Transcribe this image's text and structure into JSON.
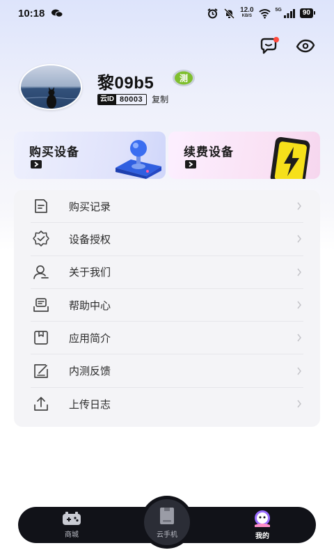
{
  "status_bar": {
    "time": "10:18",
    "net_speed_value": "12.0",
    "net_speed_unit": "KB/S",
    "network_type": "5G",
    "battery": "90"
  },
  "header": {
    "message_icon": "message-bubble-icon",
    "eye_icon": "eye-icon",
    "has_unread_dot": true
  },
  "profile": {
    "username": "黎09b5",
    "badge": "测",
    "cloud_id_label": "云ID",
    "cloud_id_value": "80003",
    "copy_label": "复制"
  },
  "cards": [
    {
      "title": "购买设备",
      "icon": "joystick-icon"
    },
    {
      "title": "续费设备",
      "icon": "lightning-phone-icon"
    }
  ],
  "menu": [
    {
      "label": "购买记录",
      "icon": "purchase-record-icon"
    },
    {
      "label": "设备授权",
      "icon": "device-auth-icon"
    },
    {
      "label": "关于我们",
      "icon": "about-us-icon"
    },
    {
      "label": "帮助中心",
      "icon": "help-center-icon"
    },
    {
      "label": "应用简介",
      "icon": "app-intro-icon"
    },
    {
      "label": "内测反馈",
      "icon": "feedback-icon"
    },
    {
      "label": "上传日志",
      "icon": "upload-log-icon"
    }
  ],
  "bottom_nav": [
    {
      "label": "商城",
      "icon": "gamepad-icon",
      "active": false
    },
    {
      "label": "云手机",
      "icon": "cloud-phone-icon",
      "active": false
    },
    {
      "label": "我的",
      "icon": "mine-avatar-icon",
      "active": true
    }
  ],
  "colors": {
    "accent_dark": "#111218",
    "badge_green": "#7fbf2e",
    "unread_dot": "#ff4a3d",
    "nav_active": "#9a6cff"
  }
}
